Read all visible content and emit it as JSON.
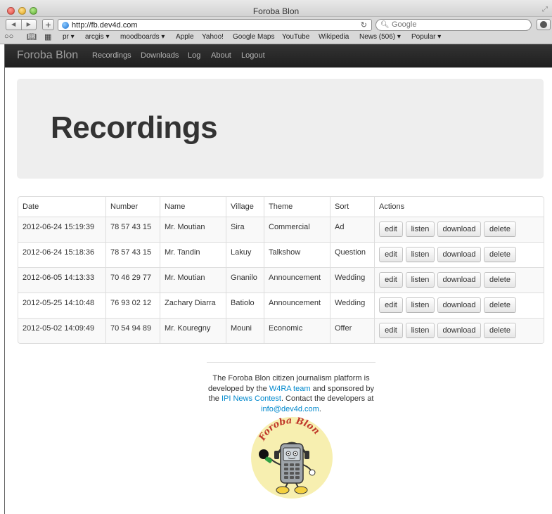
{
  "browser": {
    "title": "Foroba Blon",
    "url": "http://fb.dev4d.com",
    "search_placeholder": "Google",
    "bookmarks": [
      "pr ▾",
      "arcgis ▾",
      "moodboards ▾",
      "Apple",
      "Yahoo!",
      "Google Maps",
      "YouTube",
      "Wikipedia",
      "News (506) ▾",
      "Popular ▾"
    ]
  },
  "navbar": {
    "brand": "Foroba Blon",
    "links": [
      "Recordings",
      "Downloads",
      "Log",
      "About",
      "Logout"
    ]
  },
  "hero": {
    "title": "Recordings"
  },
  "table": {
    "headers": [
      "Date",
      "Number",
      "Name",
      "Village",
      "Theme",
      "Sort",
      "Actions"
    ],
    "actions": [
      "edit",
      "listen",
      "download",
      "delete"
    ],
    "rows": [
      [
        "2012-06-24 15:19:39",
        "78 57 43 15",
        "Mr. Moutian",
        "Sira",
        "Commercial",
        "Ad"
      ],
      [
        "2012-06-24 15:18:36",
        "78 57 43 15",
        "Mr. Tandin",
        "Lakuy",
        "Talkshow",
        "Question"
      ],
      [
        "2012-06-05 14:13:33",
        "70 46 29 77",
        "Mr. Moutian",
        "Gnanilo",
        "Announcement",
        "Wedding"
      ],
      [
        "2012-05-25 14:10:48",
        "76 93 02 12",
        "Zachary Diarra",
        "Batiolo",
        "Announcement",
        "Wedding"
      ],
      [
        "2012-05-02 14:09:49",
        "70 54 94 89",
        "Mr. Kouregny",
        "Mouni",
        "Economic",
        "Offer"
      ]
    ]
  },
  "footer": {
    "t1": "The Foroba Blon citizen journalism platform is developed by the ",
    "link1": "W4RA team",
    "t2": " and sponsored by the ",
    "link2": "IPI News Contest",
    "t3": ". Contact the developers at ",
    "link3": "info@dev4d.com",
    "t4": ".",
    "logo_text": "Foroba Blon"
  },
  "colors": {
    "navbar_bg": "#222222",
    "hero_bg": "#eeeeee",
    "link": "#0088cc",
    "logo_bg": "#f7efb0"
  }
}
